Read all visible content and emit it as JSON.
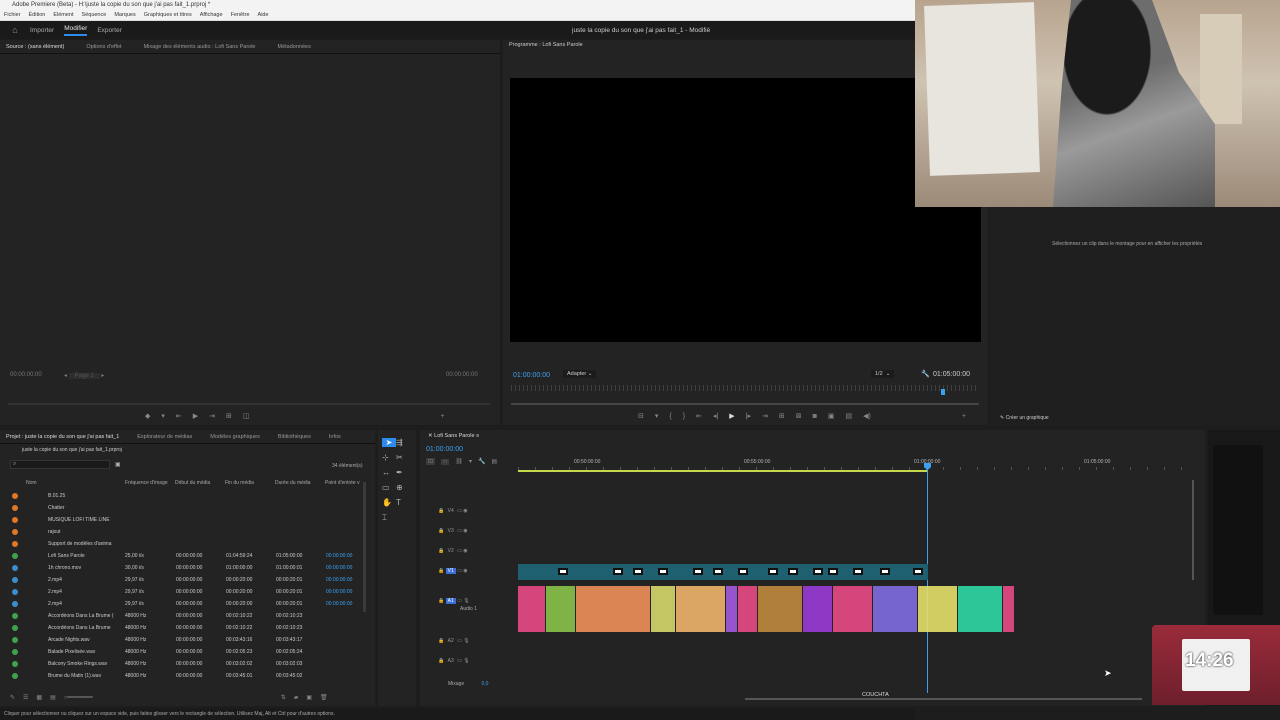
{
  "window": {
    "title": "Adobe Premiere (Beta) - H:\\juste la copie du son que j'ai pas fait_1.prproj *",
    "doc_title": "juste la copie du son que j'ai pas fait_1 - Modifié"
  },
  "menu": [
    "Fichier",
    "Édition",
    "Elément",
    "Séquence",
    "Marques",
    "Graphiques et titres",
    "Affichage",
    "Fenêtre",
    "Aide"
  ],
  "workspace_tabs": [
    "Importer",
    "Modifier",
    "Exporter"
  ],
  "source_panel": {
    "tabs": [
      "Source : (sans élément)",
      "Options d'effet",
      "Mixage des éléments audio : Lofi Sans Parole",
      "Métadonnées"
    ],
    "tc_left": "00:00:00:00",
    "tc_right": "00:00:00:00",
    "page": "Page 1"
  },
  "program_panel": {
    "title": "Programme : Lofi Sans Parole",
    "tc_current": "01:00:00:00",
    "fit": "Adapter",
    "quality": "1/2",
    "tc_duration": "01:05:00:00"
  },
  "properties": {
    "hint": "Sélectionnez un clip dans le montage pour en afficher les propriétés",
    "create_graphic": "Créer un graphique"
  },
  "project": {
    "tabs": [
      "Projet : juste la copie du son que j'ai pas fait_1",
      "Explorateur de médias",
      "Modèles graphiques",
      "Bibliothèques",
      "Infos"
    ],
    "file": "juste la copie du son que j'ai pas fait_1.prproj",
    "count": "34 élément(s)",
    "columns": [
      "Nom",
      "Fréquence d'image",
      "Début du média",
      "Fin du média",
      "Durée du média",
      "Point d'entrée v"
    ],
    "rows": [
      {
        "name": "B.01.25",
        "color": "#e0782c",
        "fps": "",
        "start": "",
        "end": "",
        "dur": "",
        "inpt": ""
      },
      {
        "name": "Chatter",
        "color": "#e0782c",
        "fps": "",
        "start": "",
        "end": "",
        "dur": "",
        "inpt": ""
      },
      {
        "name": "MUSIQUE LOFI TIME LINE",
        "color": "#e0782c",
        "fps": "",
        "start": "",
        "end": "",
        "dur": "",
        "inpt": ""
      },
      {
        "name": "rajout",
        "color": "#e0782c",
        "fps": "",
        "start": "",
        "end": "",
        "dur": "",
        "inpt": ""
      },
      {
        "name": "Support de modèles d'anima",
        "color": "#e0782c",
        "fps": "",
        "start": "",
        "end": "",
        "dur": "",
        "inpt": ""
      },
      {
        "name": "Lofi Sans Parole",
        "color": "#3fa34d",
        "fps": "25,00 i/s",
        "start": "00:00:00:00",
        "end": "01:04:59:24",
        "dur": "01:05:00:00",
        "inpt": "00:00:00:00"
      },
      {
        "name": "1h chrono.mov",
        "color": "#3b8fd0",
        "fps": "30,00 i/s",
        "start": "00:00:00:00",
        "end": "01:00:00:00",
        "dur": "01:00:00:01",
        "inpt": "00:00:00:00"
      },
      {
        "name": "2.mp4",
        "color": "#3b8fd0",
        "fps": "29,97 i/s",
        "start": "00:00:00:00",
        "end": "00:00:20:00",
        "dur": "00:00:20:01",
        "inpt": "00:00:00:00"
      },
      {
        "name": "2.mp4",
        "color": "#3b8fd0",
        "fps": "29,97 i/s",
        "start": "00:00:00:00",
        "end": "00:00:20:00",
        "dur": "00:00:20:01",
        "inpt": "00:00:00:00"
      },
      {
        "name": "2.mp4",
        "color": "#3b8fd0",
        "fps": "29,97 i/s",
        "start": "00:00:00:00",
        "end": "00:00:20:00",
        "dur": "00:00:20:01",
        "inpt": "00:00:00:00"
      },
      {
        "name": "Accordéons Dans La Brume (",
        "color": "#3fa34d",
        "fps": "48000  Hz",
        "start": "00:00:00:00",
        "end": "00:02:10:22",
        "dur": "00:02:10:23",
        "inpt": ""
      },
      {
        "name": "Accordéons Dans La Brume",
        "color": "#3fa34d",
        "fps": "48000  Hz",
        "start": "00:00:00:00",
        "end": "00:02:10:22",
        "dur": "00:02:10:23",
        "inpt": ""
      },
      {
        "name": "Arcade Nights.wav",
        "color": "#3fa34d",
        "fps": "48000  Hz",
        "start": "00:00:00:00",
        "end": "00:03:43:16",
        "dur": "00:03:43:17",
        "inpt": ""
      },
      {
        "name": "Balade Pixelisée.wav",
        "color": "#3fa34d",
        "fps": "48000  Hz",
        "start": "00:00:00:00",
        "end": "00:02:05:23",
        "dur": "00:02:05:24",
        "inpt": ""
      },
      {
        "name": "Balcony Smoke Rings.wav",
        "color": "#3fa34d",
        "fps": "48000  Hz",
        "start": "00:00:00:00",
        "end": "00:03:02:02",
        "dur": "00:03:02:03",
        "inpt": ""
      },
      {
        "name": "Brume du Matin (1).wav",
        "color": "#3fa34d",
        "fps": "48000  Hz",
        "start": "00:00:00:00",
        "end": "00:03:45:01",
        "dur": "00:03:45:02",
        "inpt": ""
      }
    ]
  },
  "timeline": {
    "tab": "Lofi Sans Parole",
    "tc": "01:00:00:00",
    "ruler": [
      "00:50:00:00",
      "00:55:00:00",
      "01:00:00:00",
      "01:05:00:00"
    ],
    "tracks": [
      "V4",
      "V3",
      "V2",
      "V1",
      "A1",
      "A2",
      "A3"
    ],
    "a1_label": "Audio 1",
    "mix_label": "Mixage",
    "mix_value": "0,0",
    "cursor_label": "COUCHTA"
  },
  "status_bar": "Cliquer pour sélectionner ou cliquez sur un espace vide, puis faites glisser vers le rectangle de sélection. Utilisez Maj, Alt et Ctrl pour d'autres options.",
  "clock_widget": {
    "time": "14:26"
  },
  "colors": {
    "accent": "#2d8ceb",
    "timecode": "#3ca0f0",
    "v1_clip": "#1e5f70"
  }
}
